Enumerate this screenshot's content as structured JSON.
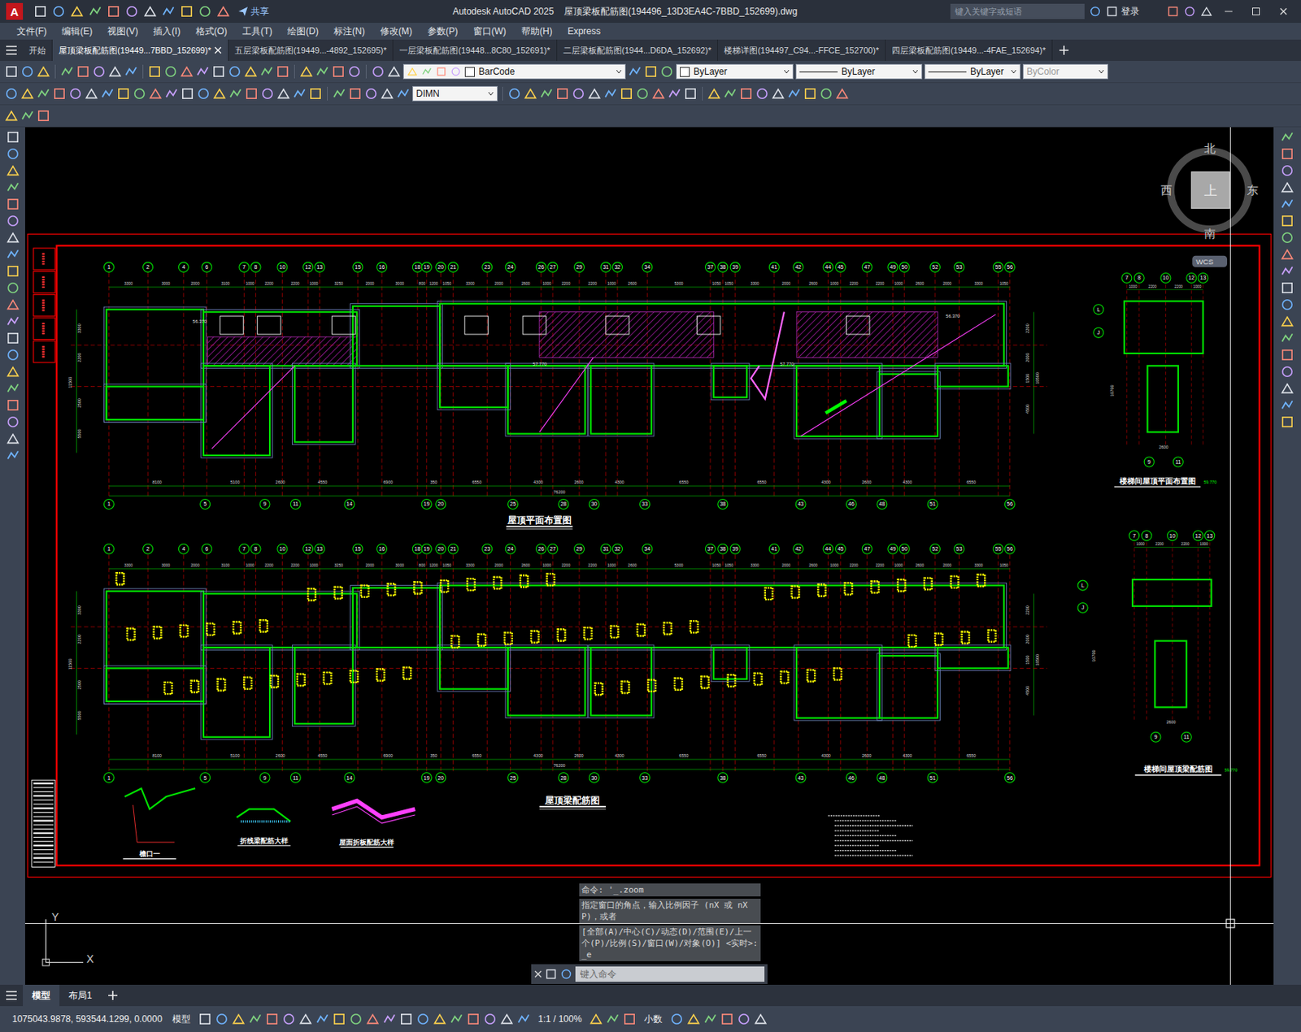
{
  "window": {
    "app_letter": "A",
    "share": "共享",
    "title": "Autodesk AutoCAD 2025    屋顶梁板配筋图(194496_13D3EA4C-7BBD_152699).dwg",
    "search_placeholder": "键入关键字或短语",
    "login": "登录"
  },
  "menu": [
    "文件(F)",
    "编辑(E)",
    "视图(V)",
    "插入(I)",
    "格式(O)",
    "工具(T)",
    "绘图(D)",
    "标注(N)",
    "修改(M)",
    "参数(P)",
    "窗口(W)",
    "帮助(H)",
    "Express"
  ],
  "doc_tabs": [
    {
      "label": "开始",
      "selected": false,
      "closable": false
    },
    {
      "label": "屋顶梁板配筋图(19449...7BBD_152699)*",
      "selected": true,
      "closable": true
    },
    {
      "label": "五层梁板配筋图(19449...-4892_152695)*",
      "selected": false,
      "closable": false
    },
    {
      "label": "一层梁板配筋图(19448...8C80_152691)*",
      "selected": false,
      "closable": false
    },
    {
      "label": "二层梁板配筋图(1944...D6DA_152692)*",
      "selected": false,
      "closable": false
    },
    {
      "label": "楼梯详图(194497_C94...-FFCE_152700)*",
      "selected": false,
      "closable": false
    },
    {
      "label": "四层梁板配筋图(19449...-4FAE_152694)*",
      "selected": false,
      "closable": false
    }
  ],
  "toolbar": {
    "layer": "BarCode",
    "color": "ByLayer",
    "linetype": "ByLayer",
    "lineweight": "ByLayer",
    "plotstyle": "ByColor",
    "dimstyle": "DIMN"
  },
  "viewcube": {
    "north": "北",
    "south": "南",
    "east": "东",
    "west": "西",
    "top": "上",
    "ucs": "WCS"
  },
  "command": {
    "history": [
      "命令: '_.zoom",
      "指定窗口的角点，输入比例因子 (nX 或 nXP)，或者",
      "[全部(A)/中心(C)/动态(D)/范围(E)/上一个(P)/比例(S)/窗口(W)/对象(O)] <实时>: _e"
    ],
    "placeholder": "键入命令"
  },
  "ucs_icon": {
    "x": "X",
    "y": "Y"
  },
  "drawing": {
    "plans": [
      {
        "title": "屋顶平面布置图",
        "kind": "layout"
      },
      {
        "title": "屋顶梁配筋图",
        "kind": "rebar"
      }
    ],
    "top_axes": [
      "1",
      "2",
      "4",
      "6",
      "7",
      "8",
      "10",
      "12",
      "13",
      "15",
      "16",
      "18",
      "19",
      "20",
      "21",
      "23",
      "24",
      "26",
      "27",
      "29",
      "31",
      "32",
      "34",
      "37",
      "38",
      "39",
      "41",
      "42",
      "44",
      "45",
      "47",
      "49",
      "50",
      "52",
      "53",
      "55",
      "56"
    ],
    "top_dims": [
      "3300",
      "3000",
      "2000",
      "3100",
      "1000",
      "2200",
      "2200",
      "1000",
      "3250",
      "2000",
      "3000",
      "800",
      "1200",
      "1050",
      "3300",
      "2000",
      "2600",
      "1000",
      "2200",
      "2200",
      "1000",
      "2600",
      "5300",
      "1050",
      "1050",
      "3300",
      "2000",
      "2600",
      "1000",
      "2200",
      "2200",
      "1000",
      "2600",
      "2000",
      "3300",
      "1050"
    ],
    "bottom_axes": [
      "1",
      "5",
      "9",
      "11",
      "14",
      "19",
      "20",
      "25",
      "28",
      "30",
      "33",
      "38",
      "43",
      "46",
      "48",
      "51",
      "56"
    ],
    "bottom_dims": [
      "8100",
      "5100",
      "2600",
      "4550",
      "6900",
      "350",
      "6550",
      "4300",
      "2600",
      "4300",
      "6550",
      "6550",
      "4300",
      "2600",
      "4300",
      "6550"
    ],
    "total": "76200",
    "left_dims": [
      "3300",
      "2200",
      "2500",
      "5500",
      "11500"
    ],
    "right_dims": [
      "2200",
      "2000",
      "1500",
      "4500",
      "10500"
    ],
    "elevations": [
      "56.370",
      "57.770",
      "57.770",
      "56.370"
    ],
    "stair_plans": [
      {
        "title": "楼梯间屋顶平面布置图",
        "level": "59.770",
        "top_axes": [
          "7",
          "8",
          "10",
          "12",
          "13"
        ],
        "top_dims": [
          "1000",
          "2200",
          "2200",
          "1000"
        ],
        "left_axes": [
          "L",
          "J"
        ],
        "bottom_axes": [
          "9",
          "11"
        ],
        "bottom_dim": "2600",
        "left_dim": "10700"
      },
      {
        "title": "楼梯间屋顶梁配筋图",
        "level": "59.770",
        "top_axes": [
          "7",
          "8",
          "10",
          "12",
          "13"
        ],
        "top_dims": [
          "1000",
          "2200",
          "2200",
          "1000"
        ],
        "left_axes": [
          "L",
          "J"
        ],
        "bottom_axes": [
          "9",
          "11"
        ],
        "bottom_dim": "2600",
        "left_dim": "10700"
      }
    ],
    "details": [
      "檐口一",
      "折线梁配筋大样",
      "屋面折板配筋大样"
    ]
  },
  "layout_tabs": [
    {
      "label": "模型",
      "selected": true
    },
    {
      "label": "布局1",
      "selected": false
    }
  ],
  "status_bar": {
    "coords": "1075043.9878, 593544.1299, 0.0000",
    "space": "模型",
    "scale": "1:1 / 100%",
    "units": "小数"
  }
}
